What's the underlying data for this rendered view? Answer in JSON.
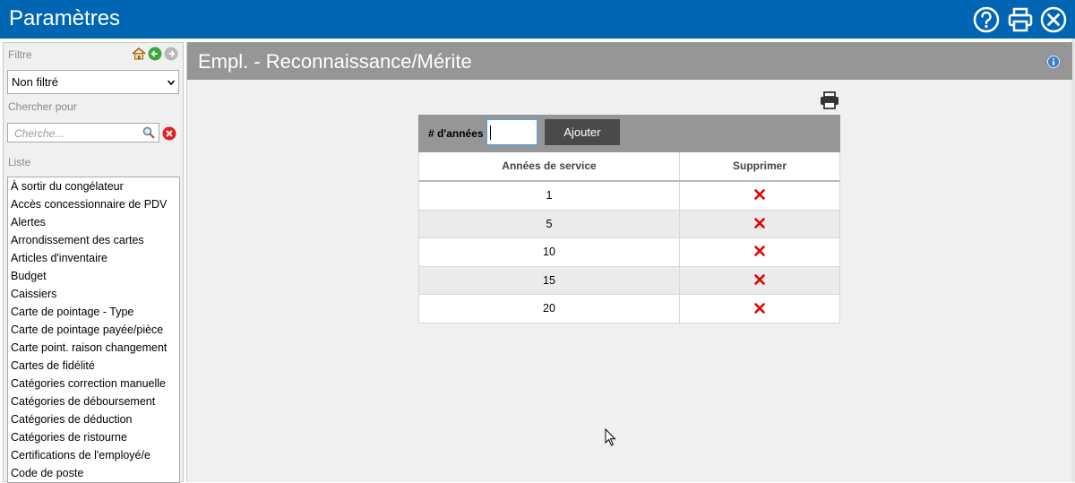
{
  "window": {
    "title": "Paramètres",
    "buttons": [
      "help-icon",
      "print-icon",
      "close-icon"
    ],
    "brand_color": "#0066b3"
  },
  "sidebar": {
    "filter_label": "Filtre",
    "filter_select_value": "Non filtré",
    "search_label": "Chercher pour",
    "search_placeholder": "Cherche...",
    "list_label": "Liste",
    "items": [
      "À sortir du congélateur",
      "Accès concessionnaire de PDV",
      "Alertes",
      "Arrondissement des cartes",
      "Articles d'inventaire",
      "Budget",
      "Caissiers",
      "Carte de pointage - Type",
      "Carte de pointage payée/pièce",
      "Carte point. raison changement",
      "Cartes de fidélité",
      "Catégories correction manuelle",
      "Catégories de déboursement",
      "Catégories de déduction",
      "Catégories de ristourne",
      "Certifications de l'employé/e",
      "Code de poste"
    ]
  },
  "main": {
    "section_title": "Empl. - Reconnaissance/Mérite",
    "form": {
      "years_label": "# d'années",
      "years_value": "",
      "add_button": "Ajouter"
    },
    "table": {
      "headers": [
        "Années de service",
        "Supprimer"
      ],
      "rows": [
        {
          "years": "1"
        },
        {
          "years": "5"
        },
        {
          "years": "10"
        },
        {
          "years": "15"
        },
        {
          "years": "20"
        }
      ]
    },
    "colors": {
      "header_gray": "#969696",
      "delete_red": "#e00000"
    }
  }
}
